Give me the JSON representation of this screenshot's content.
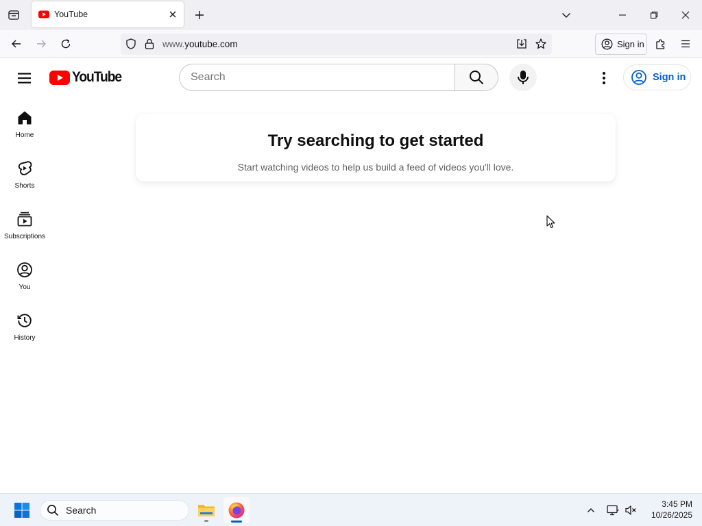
{
  "browser": {
    "tab": {
      "title": "YouTube"
    },
    "url": {
      "prefix": "www.",
      "domain": "youtube.com"
    },
    "signin_label": "Sign in"
  },
  "youtube": {
    "logo_text": "YouTube",
    "search": {
      "placeholder": "Search"
    },
    "signin_label": "Sign in",
    "brand_color": "#ff0000",
    "link_color": "#065fd4",
    "guide": [
      {
        "label": "Home",
        "icon": "home-icon"
      },
      {
        "label": "Shorts",
        "icon": "shorts-icon"
      },
      {
        "label": "Subscriptions",
        "icon": "subscriptions-icon"
      },
      {
        "label": "You",
        "icon": "you-icon"
      },
      {
        "label": "History",
        "icon": "history-icon"
      }
    ],
    "nudge": {
      "title": "Try searching to get started",
      "subtitle": "Start watching videos to help us build a feed of videos you'll love."
    }
  },
  "taskbar": {
    "search_label": "Search",
    "time": "3:45 PM",
    "date": "10/26/2025"
  }
}
